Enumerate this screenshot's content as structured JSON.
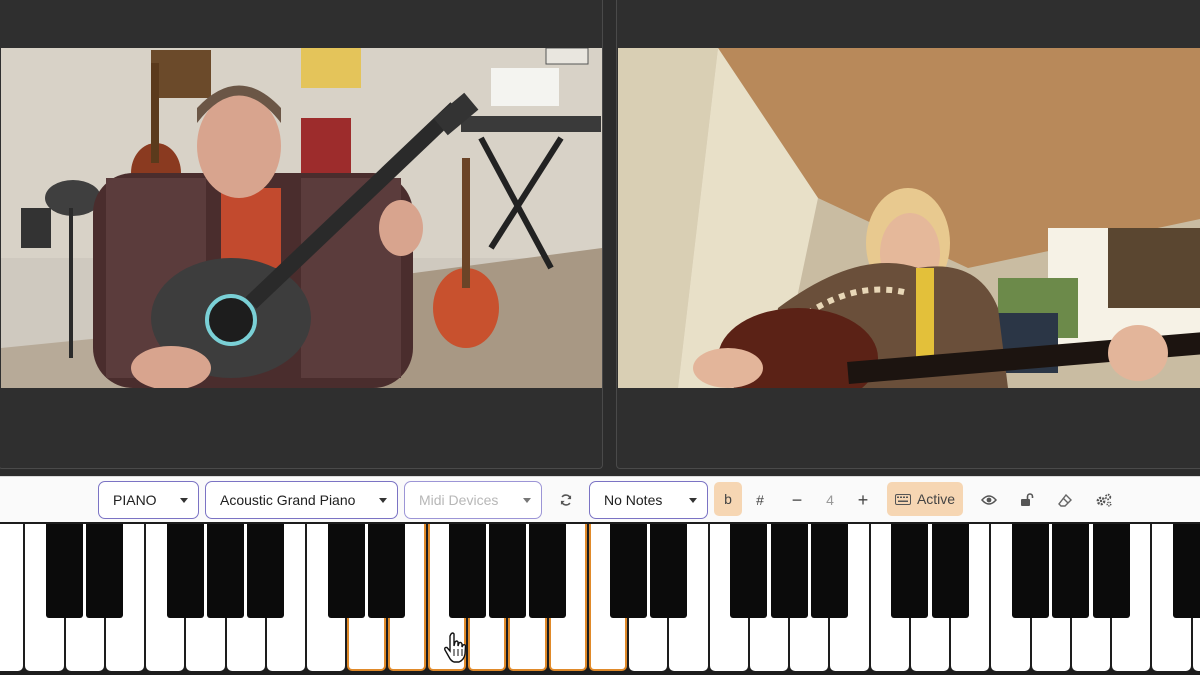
{
  "toolbar": {
    "instrument": "PIANO",
    "sound": "Acoustic Grand Piano",
    "midi_placeholder": "Midi Devices",
    "refresh_icon": "refresh-icon",
    "notes": "No Notes",
    "flat_label": "b",
    "sharp_label": "#",
    "minus_label": "−",
    "octave_value": "4",
    "plus_label": "+",
    "keyboard_icon": "keyboard-icon",
    "active_label": "Active",
    "eye_icon": "eye-icon",
    "lock_icon": "unlock-icon",
    "eraser_icon": "eraser-icon",
    "settings_icon": "gears-icon"
  },
  "colors": {
    "accent": "#f6d6b3",
    "select_border": "#7b73c4",
    "key_highlight": "#e08a2a"
  },
  "piano": {
    "highlighted_white_keys": [
      9,
      10,
      11,
      12,
      13,
      14,
      15
    ]
  }
}
